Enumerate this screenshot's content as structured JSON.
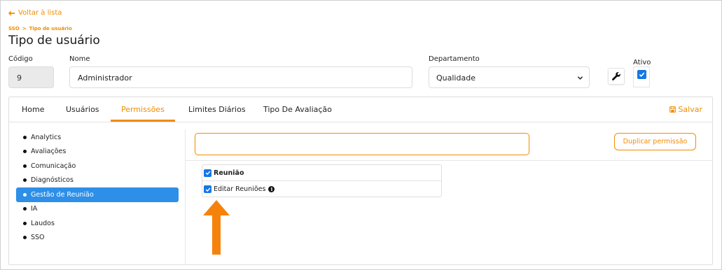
{
  "back_link": {
    "label": "Voltar à lista",
    "icon": "arrow-left-icon"
  },
  "breadcrumb": {
    "root": "SSO",
    "separator": ">",
    "current": "Tipo de usuário"
  },
  "page_title": "Tipo de usuário",
  "form": {
    "code": {
      "label": "Código",
      "value": "9"
    },
    "name": {
      "label": "Nome",
      "value": "Administrador"
    },
    "department": {
      "label": "Departamento",
      "value": "Qualidade"
    },
    "active": {
      "label": "Ativo",
      "checked": true
    }
  },
  "tabs": [
    {
      "label": "Home",
      "active": false
    },
    {
      "label": "Usuários",
      "active": false
    },
    {
      "label": "Permissões",
      "active": true
    },
    {
      "label": "Limites Diários",
      "active": false
    },
    {
      "label": "Tipo De Avaliação",
      "active": false
    }
  ],
  "save_label": "Salvar",
  "sidebar": {
    "items": [
      {
        "label": "Analytics",
        "active": false
      },
      {
        "label": "Avaliações",
        "active": false
      },
      {
        "label": "Comunicação",
        "active": false
      },
      {
        "label": "Diagnósticos",
        "active": false
      },
      {
        "label": "Gestão de Reunião",
        "active": true
      },
      {
        "label": "IA",
        "active": false
      },
      {
        "label": "Laudos",
        "active": false
      },
      {
        "label": "SSO",
        "active": false
      }
    ]
  },
  "search": {
    "placeholder": "",
    "value": ""
  },
  "duplicate_button": "Duplicar permissão",
  "permissions": {
    "group": {
      "label": "Reunião",
      "checked": true
    },
    "items": [
      {
        "label": "Editar Reuniões",
        "checked": true,
        "icon": "info-icon"
      }
    ]
  },
  "colors": {
    "accent": "#f28c00",
    "active_blue": "#2d8fe8",
    "checkbox_blue": "#1677e6"
  }
}
